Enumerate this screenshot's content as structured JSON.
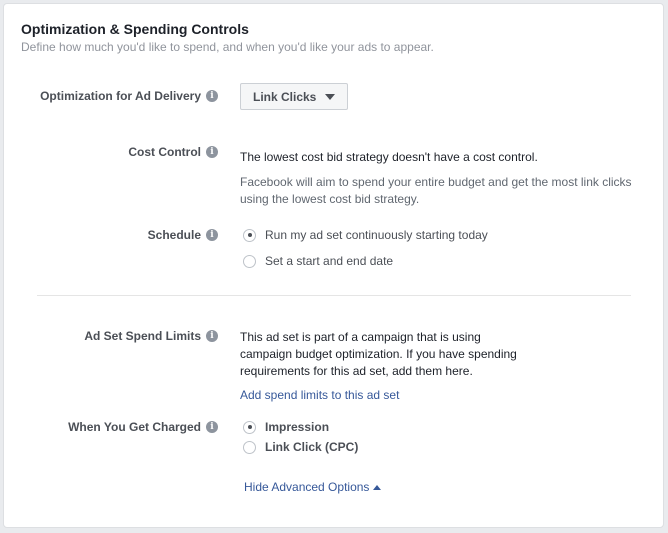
{
  "section": {
    "title": "Optimization & Spending Controls",
    "subtitle": "Define how much you'd like to spend, and when you'd like your ads to appear."
  },
  "optimization": {
    "label": "Optimization for Ad Delivery",
    "info_icon": "info-icon",
    "selected": "Link Clicks",
    "dropdown_icon": "caret-down-icon"
  },
  "cost_control": {
    "label": "Cost Control",
    "info_icon": "info-icon",
    "text": "The lowest cost bid strategy doesn't have a cost control.",
    "description": "Facebook will aim to spend your entire budget and get the most link clicks using the lowest cost bid strategy."
  },
  "schedule": {
    "label": "Schedule",
    "info_icon": "info-icon",
    "options": [
      {
        "label": "Run my ad set continuously starting today",
        "checked": true
      },
      {
        "label": "Set a start and end date",
        "checked": false
      }
    ]
  },
  "spend_limits": {
    "label": "Ad Set Spend Limits",
    "info_icon": "info-icon",
    "text_lines": [
      "This ad set is part of a campaign that is using",
      "campaign budget optimization. If you have spending",
      "requirements for this ad set, add them here."
    ],
    "link": "Add spend limits to this ad set"
  },
  "charged": {
    "label": "When You Get Charged",
    "info_icon": "info-icon",
    "options": [
      {
        "label": "Impression",
        "checked": true
      },
      {
        "label": "Link Click (CPC)",
        "checked": false
      }
    ]
  },
  "advanced": {
    "link": "Hide Advanced Options",
    "icon": "caret-up-icon"
  },
  "colors": {
    "link": "#365899",
    "label": "#4b4f56",
    "muted": "#90949c",
    "background": "#e9ebee"
  }
}
